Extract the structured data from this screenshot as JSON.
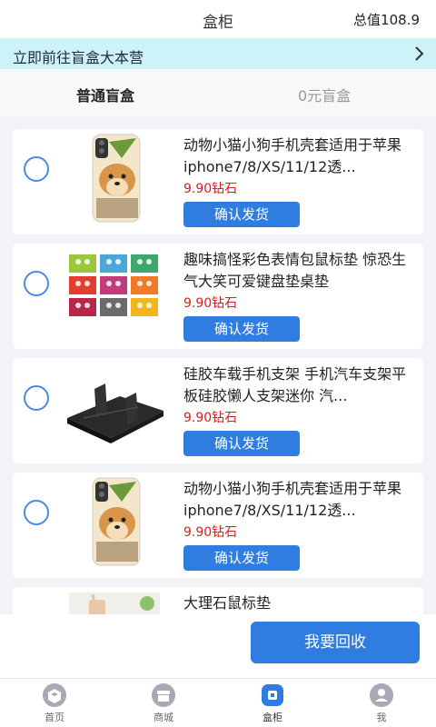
{
  "header": {
    "title": "盒柜",
    "total": "总值108.9"
  },
  "banner": {
    "text": "立即前往盲盒大本营"
  },
  "tabs": [
    {
      "label": "普通盲盒"
    },
    {
      "label": "0元盲盒"
    }
  ],
  "items": [
    {
      "name": "动物小猫小狗手机壳套适用于苹果iphone7/8/XS/11/12透...",
      "price": "9.90钻石",
      "button": "确认发货"
    },
    {
      "name": "趣味搞怪彩色表情包鼠标垫 惊恐生气大笑可爱键盘垫桌垫",
      "price": "9.90钻石",
      "button": "确认发货"
    },
    {
      "name": "硅胶车载手机支架 手机汽车支架平板硅胶懒人支架迷你 汽...",
      "price": "9.90钻石",
      "button": "确认发货"
    },
    {
      "name": "动物小猫小狗手机壳套适用于苹果iphone7/8/XS/11/12透...",
      "price": "9.90钻石",
      "button": "确认发货"
    },
    {
      "name": "大理石鼠标垫",
      "price": "",
      "button": ""
    }
  ],
  "recycle_button": "我要回收",
  "tabbar": [
    {
      "label": "首页"
    },
    {
      "label": "商城"
    },
    {
      "label": "盒柜"
    },
    {
      "label": "我"
    }
  ],
  "colors": {
    "accent": "#2f7de1",
    "price": "#d62020",
    "banner": "#cdf3f8",
    "radio": "#4a8ae6"
  }
}
